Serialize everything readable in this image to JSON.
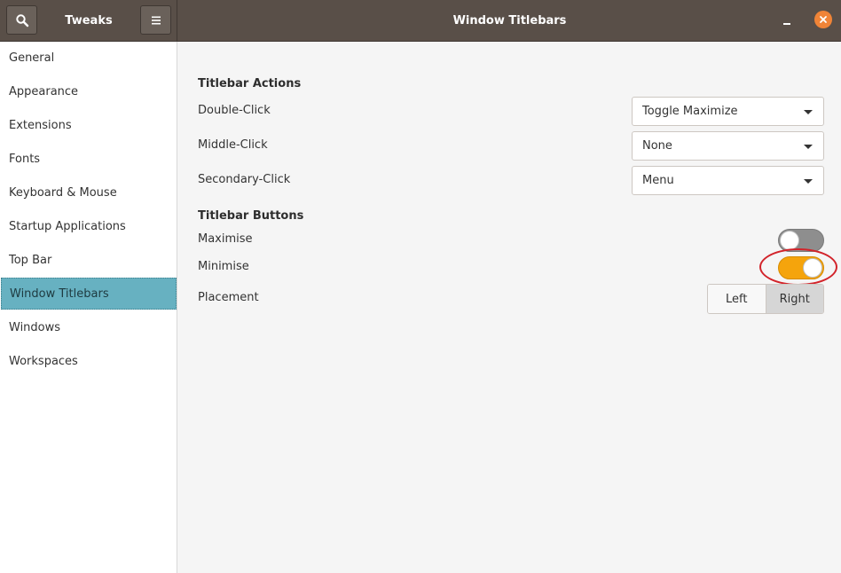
{
  "header": {
    "app_title": "Tweaks",
    "window_title": "Window Titlebars",
    "search_icon": "search-icon",
    "menu_icon": "hamburger-menu-icon",
    "minimize_icon": "minimize-icon",
    "close_icon": "close-icon"
  },
  "sidebar": {
    "items": [
      {
        "label": "General"
      },
      {
        "label": "Appearance"
      },
      {
        "label": "Extensions"
      },
      {
        "label": "Fonts"
      },
      {
        "label": "Keyboard & Mouse"
      },
      {
        "label": "Startup Applications"
      },
      {
        "label": "Top Bar"
      },
      {
        "label": "Window Titlebars",
        "selected": true
      },
      {
        "label": "Windows"
      },
      {
        "label": "Workspaces"
      }
    ]
  },
  "main": {
    "actions_title": "Titlebar Actions",
    "double_click_label": "Double-Click",
    "double_click_value": "Toggle Maximize",
    "middle_click_label": "Middle-Click",
    "middle_click_value": "None",
    "secondary_click_label": "Secondary-Click",
    "secondary_click_value": "Menu",
    "buttons_title": "Titlebar Buttons",
    "maximise_label": "Maximise",
    "maximise_on": false,
    "minimise_label": "Minimise",
    "minimise_on": true,
    "placement_label": "Placement",
    "placement_left": "Left",
    "placement_right": "Right",
    "placement_selected": "Right"
  },
  "colors": {
    "headerbar": "#594f48",
    "selection": "#67b1c1",
    "switch_on": "#f5a40c",
    "close_button": "#f08437",
    "highlight_ring": "#d2232a"
  }
}
